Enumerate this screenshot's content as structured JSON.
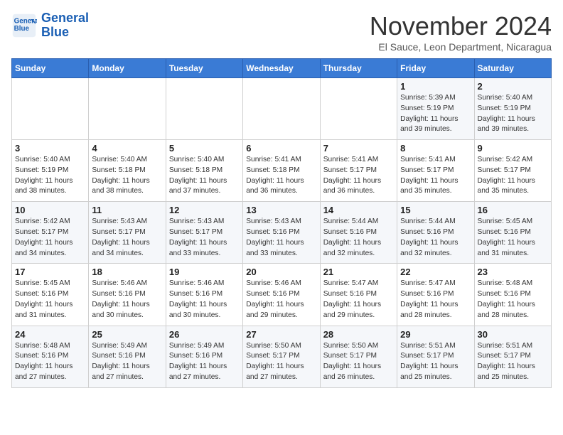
{
  "header": {
    "logo_line1": "General",
    "logo_line2": "Blue",
    "month_title": "November 2024",
    "subtitle": "El Sauce, Leon Department, Nicaragua"
  },
  "calendar": {
    "days_of_week": [
      "Sunday",
      "Monday",
      "Tuesday",
      "Wednesday",
      "Thursday",
      "Friday",
      "Saturday"
    ],
    "weeks": [
      [
        {
          "day": "",
          "info": ""
        },
        {
          "day": "",
          "info": ""
        },
        {
          "day": "",
          "info": ""
        },
        {
          "day": "",
          "info": ""
        },
        {
          "day": "",
          "info": ""
        },
        {
          "day": "1",
          "info": "Sunrise: 5:39 AM\nSunset: 5:19 PM\nDaylight: 11 hours and 39 minutes."
        },
        {
          "day": "2",
          "info": "Sunrise: 5:40 AM\nSunset: 5:19 PM\nDaylight: 11 hours and 39 minutes."
        }
      ],
      [
        {
          "day": "3",
          "info": "Sunrise: 5:40 AM\nSunset: 5:19 PM\nDaylight: 11 hours and 38 minutes."
        },
        {
          "day": "4",
          "info": "Sunrise: 5:40 AM\nSunset: 5:18 PM\nDaylight: 11 hours and 38 minutes."
        },
        {
          "day": "5",
          "info": "Sunrise: 5:40 AM\nSunset: 5:18 PM\nDaylight: 11 hours and 37 minutes."
        },
        {
          "day": "6",
          "info": "Sunrise: 5:41 AM\nSunset: 5:18 PM\nDaylight: 11 hours and 36 minutes."
        },
        {
          "day": "7",
          "info": "Sunrise: 5:41 AM\nSunset: 5:17 PM\nDaylight: 11 hours and 36 minutes."
        },
        {
          "day": "8",
          "info": "Sunrise: 5:41 AM\nSunset: 5:17 PM\nDaylight: 11 hours and 35 minutes."
        },
        {
          "day": "9",
          "info": "Sunrise: 5:42 AM\nSunset: 5:17 PM\nDaylight: 11 hours and 35 minutes."
        }
      ],
      [
        {
          "day": "10",
          "info": "Sunrise: 5:42 AM\nSunset: 5:17 PM\nDaylight: 11 hours and 34 minutes."
        },
        {
          "day": "11",
          "info": "Sunrise: 5:43 AM\nSunset: 5:17 PM\nDaylight: 11 hours and 34 minutes."
        },
        {
          "day": "12",
          "info": "Sunrise: 5:43 AM\nSunset: 5:17 PM\nDaylight: 11 hours and 33 minutes."
        },
        {
          "day": "13",
          "info": "Sunrise: 5:43 AM\nSunset: 5:16 PM\nDaylight: 11 hours and 33 minutes."
        },
        {
          "day": "14",
          "info": "Sunrise: 5:44 AM\nSunset: 5:16 PM\nDaylight: 11 hours and 32 minutes."
        },
        {
          "day": "15",
          "info": "Sunrise: 5:44 AM\nSunset: 5:16 PM\nDaylight: 11 hours and 32 minutes."
        },
        {
          "day": "16",
          "info": "Sunrise: 5:45 AM\nSunset: 5:16 PM\nDaylight: 11 hours and 31 minutes."
        }
      ],
      [
        {
          "day": "17",
          "info": "Sunrise: 5:45 AM\nSunset: 5:16 PM\nDaylight: 11 hours and 31 minutes."
        },
        {
          "day": "18",
          "info": "Sunrise: 5:46 AM\nSunset: 5:16 PM\nDaylight: 11 hours and 30 minutes."
        },
        {
          "day": "19",
          "info": "Sunrise: 5:46 AM\nSunset: 5:16 PM\nDaylight: 11 hours and 30 minutes."
        },
        {
          "day": "20",
          "info": "Sunrise: 5:46 AM\nSunset: 5:16 PM\nDaylight: 11 hours and 29 minutes."
        },
        {
          "day": "21",
          "info": "Sunrise: 5:47 AM\nSunset: 5:16 PM\nDaylight: 11 hours and 29 minutes."
        },
        {
          "day": "22",
          "info": "Sunrise: 5:47 AM\nSunset: 5:16 PM\nDaylight: 11 hours and 28 minutes."
        },
        {
          "day": "23",
          "info": "Sunrise: 5:48 AM\nSunset: 5:16 PM\nDaylight: 11 hours and 28 minutes."
        }
      ],
      [
        {
          "day": "24",
          "info": "Sunrise: 5:48 AM\nSunset: 5:16 PM\nDaylight: 11 hours and 27 minutes."
        },
        {
          "day": "25",
          "info": "Sunrise: 5:49 AM\nSunset: 5:16 PM\nDaylight: 11 hours and 27 minutes."
        },
        {
          "day": "26",
          "info": "Sunrise: 5:49 AM\nSunset: 5:16 PM\nDaylight: 11 hours and 27 minutes."
        },
        {
          "day": "27",
          "info": "Sunrise: 5:50 AM\nSunset: 5:17 PM\nDaylight: 11 hours and 27 minutes."
        },
        {
          "day": "28",
          "info": "Sunrise: 5:50 AM\nSunset: 5:17 PM\nDaylight: 11 hours and 26 minutes."
        },
        {
          "day": "29",
          "info": "Sunrise: 5:51 AM\nSunset: 5:17 PM\nDaylight: 11 hours and 25 minutes."
        },
        {
          "day": "30",
          "info": "Sunrise: 5:51 AM\nSunset: 5:17 PM\nDaylight: 11 hours and 25 minutes."
        }
      ]
    ]
  }
}
